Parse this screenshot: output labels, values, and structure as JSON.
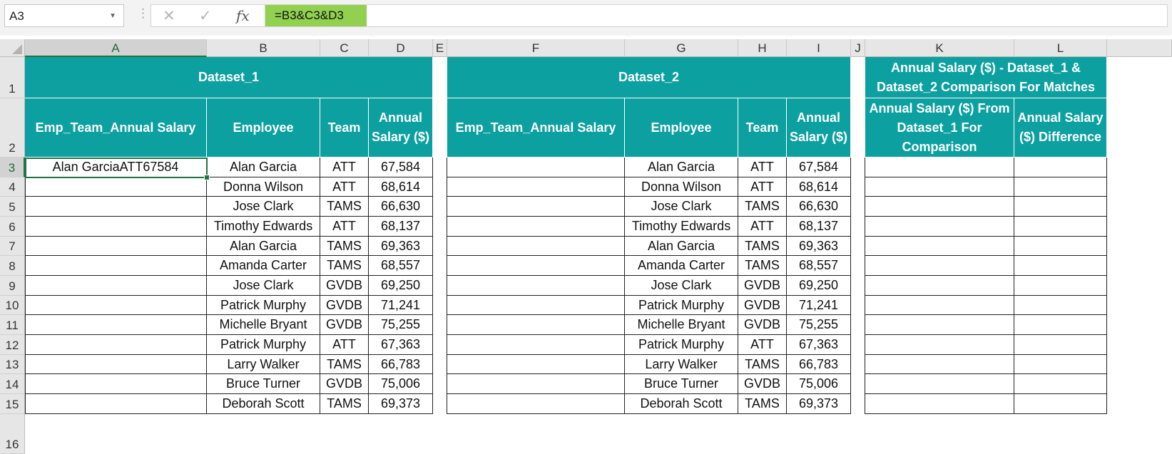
{
  "formula_bar": {
    "name_box": "A3",
    "formula": "=B3&C3&D3",
    "icons": [
      "cancel-icon",
      "enter-icon",
      "fx-icon"
    ]
  },
  "columns": [
    "A",
    "B",
    "C",
    "D",
    "E",
    "F",
    "G",
    "H",
    "I",
    "J",
    "K",
    "L"
  ],
  "rows": [
    "1",
    "2",
    "3",
    "4",
    "5",
    "6",
    "7",
    "8",
    "9",
    "10",
    "11",
    "12",
    "13",
    "14",
    "15",
    "16"
  ],
  "selected_cell": "A3",
  "colors": {
    "header_fill": "#0ca0a0",
    "formula_highlight": "#92d050",
    "selection": "#217346"
  },
  "dataset1": {
    "title": "Dataset_1",
    "headers": [
      "Emp_Team_Annual Salary",
      "Employee",
      "Team",
      "Annual Salary ($)"
    ],
    "combined_value": "Alan GarciaATT67584",
    "rows": [
      [
        "Alan Garcia",
        "ATT",
        "67,584"
      ],
      [
        "Donna Wilson",
        "ATT",
        "68,614"
      ],
      [
        "Jose Clark",
        "TAMS",
        "66,630"
      ],
      [
        "Timothy Edwards",
        "ATT",
        "68,137"
      ],
      [
        "Alan Garcia",
        "TAMS",
        "69,363"
      ],
      [
        "Amanda Carter",
        "TAMS",
        "68,557"
      ],
      [
        "Jose Clark",
        "GVDB",
        "69,250"
      ],
      [
        "Patrick Murphy",
        "GVDB",
        "71,241"
      ],
      [
        "Michelle Bryant",
        "GVDB",
        "75,255"
      ],
      [
        "Patrick Murphy",
        "ATT",
        "67,363"
      ],
      [
        "Larry Walker",
        "TAMS",
        "66,783"
      ],
      [
        "Bruce Turner",
        "GVDB",
        "75,006"
      ],
      [
        "Deborah Scott",
        "TAMS",
        "69,373"
      ]
    ]
  },
  "dataset2": {
    "title": "Dataset_2",
    "headers": [
      "Emp_Team_Annual Salary",
      "Employee",
      "Team",
      "Annual Salary ($)"
    ],
    "rows": [
      [
        "Alan Garcia",
        "ATT",
        "67,584"
      ],
      [
        "Donna Wilson",
        "ATT",
        "68,614"
      ],
      [
        "Jose Clark",
        "TAMS",
        "66,630"
      ],
      [
        "Timothy Edwards",
        "ATT",
        "68,137"
      ],
      [
        "Alan Garcia",
        "TAMS",
        "69,363"
      ],
      [
        "Amanda Carter",
        "TAMS",
        "68,557"
      ],
      [
        "Jose Clark",
        "GVDB",
        "69,250"
      ],
      [
        "Patrick Murphy",
        "GVDB",
        "71,241"
      ],
      [
        "Michelle Bryant",
        "GVDB",
        "75,255"
      ],
      [
        "Patrick Murphy",
        "ATT",
        "67,363"
      ],
      [
        "Larry Walker",
        "TAMS",
        "66,783"
      ],
      [
        "Bruce Turner",
        "GVDB",
        "75,006"
      ],
      [
        "Deborah Scott",
        "TAMS",
        "69,373"
      ]
    ]
  },
  "comparison": {
    "title": "Annual Salary ($) - Dataset_1 & Dataset_2 Comparison For Matches",
    "headers": [
      "Annual Salary ($) From Dataset_1 For Comparison",
      "Annual Salary ($) Difference"
    ]
  }
}
